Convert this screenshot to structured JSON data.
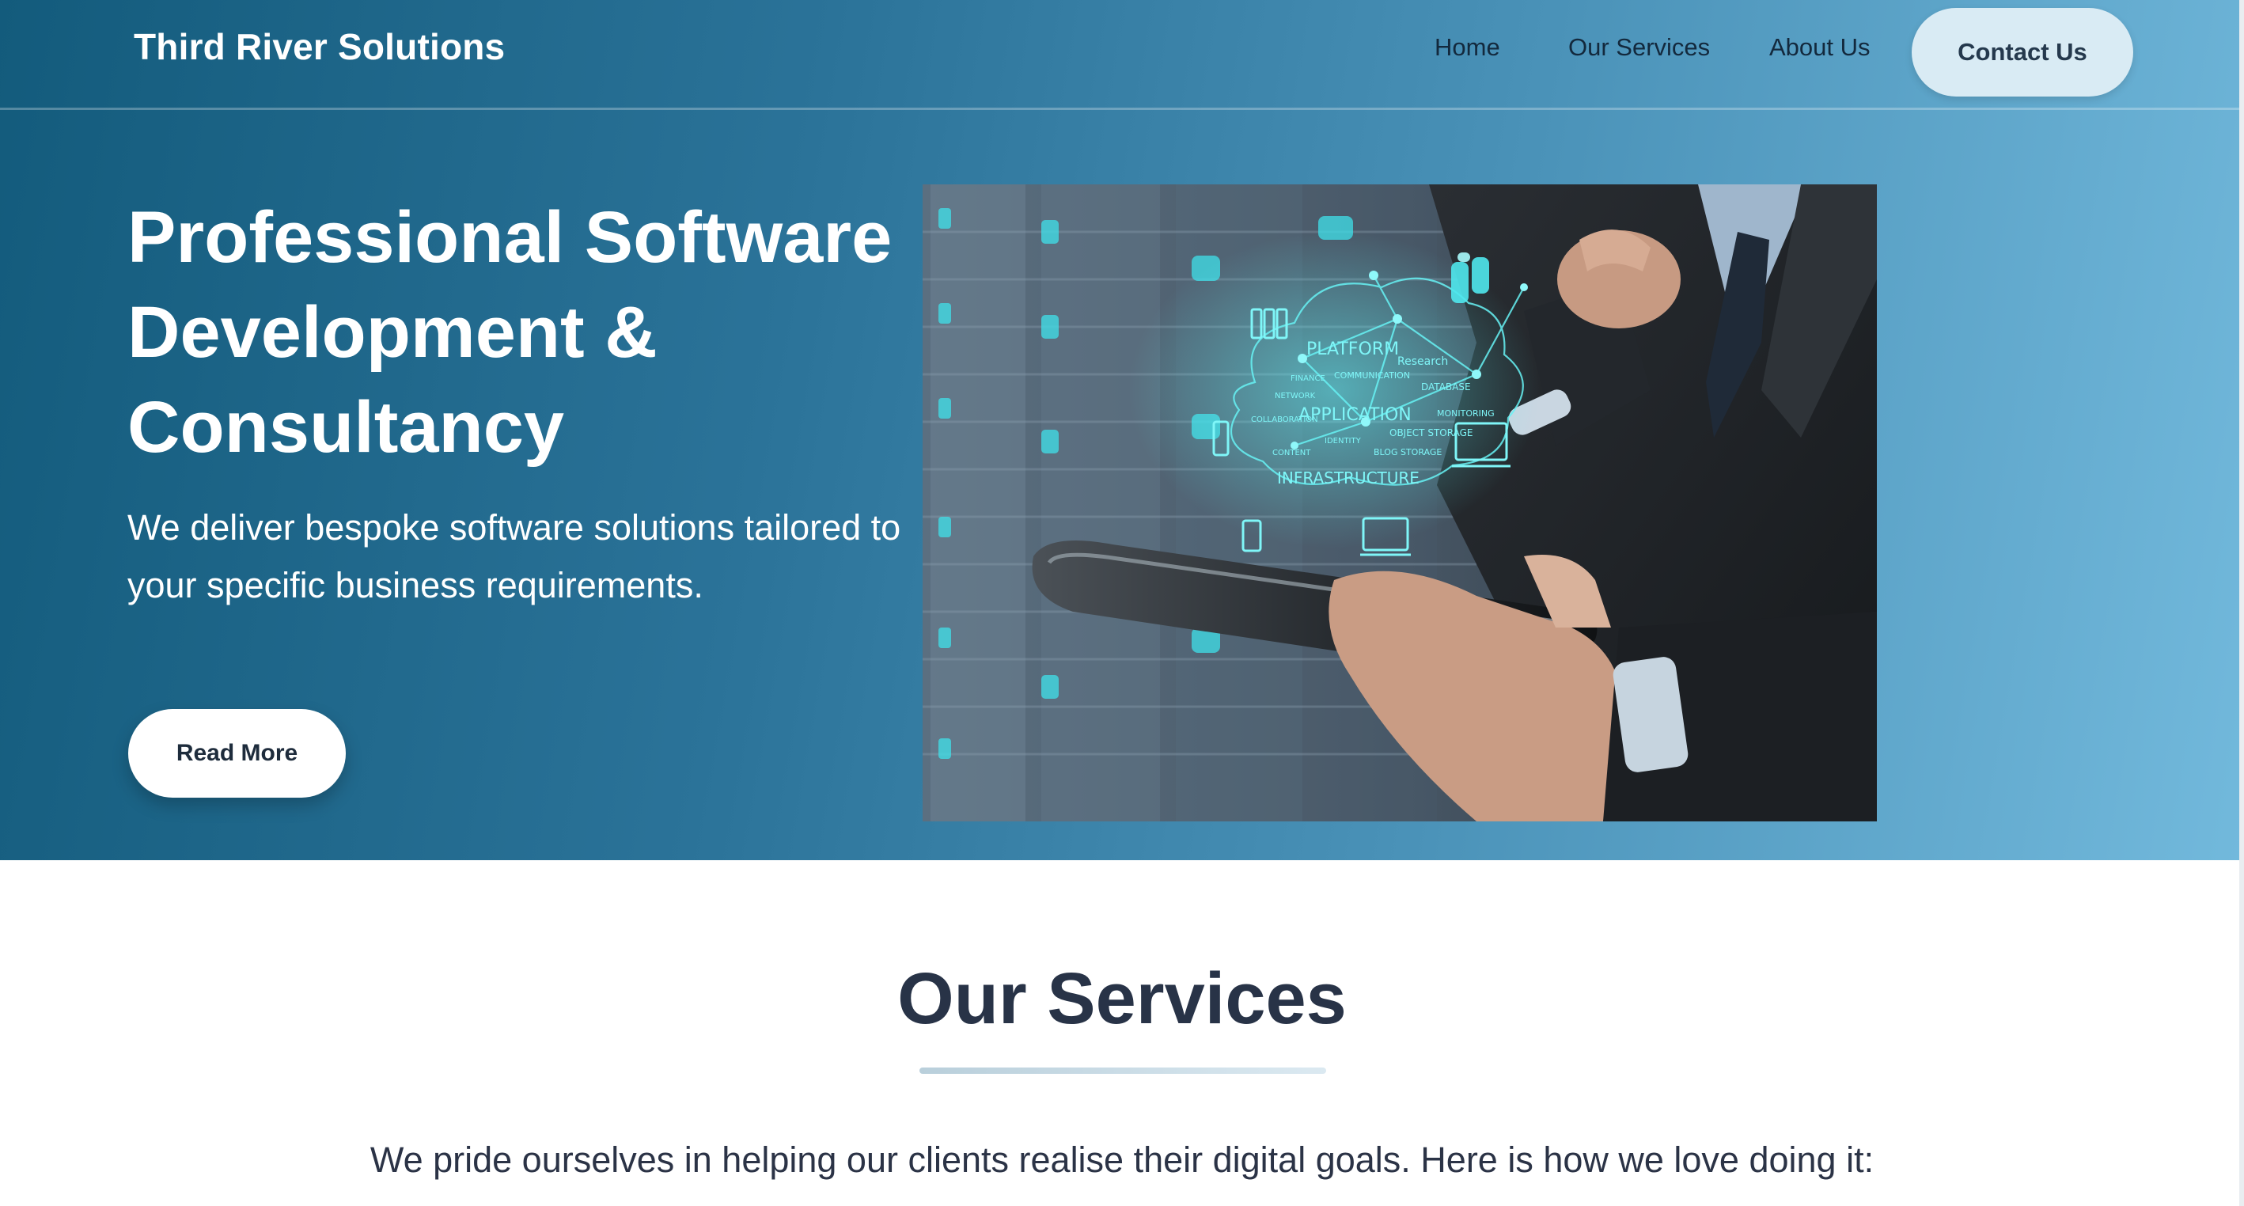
{
  "header": {
    "brand": "Third River Solutions",
    "nav": [
      {
        "label": "Home"
      },
      {
        "label": "Our Services"
      },
      {
        "label": "About Us"
      }
    ],
    "cta_label": "Contact Us"
  },
  "hero": {
    "title": "Professional Software Development & Consultancy",
    "subtitle": "We deliver bespoke software solutions tailored to your specific business requirements.",
    "button_label": "Read More",
    "image_words": {
      "platform": "PLATFORM",
      "application": "APPLICATION",
      "infrastructure": "INFRASTRUCTURE",
      "database": "DATABASE",
      "object_storage": "OBJECT STORAGE",
      "blog_storage": "BLOG STORAGE",
      "research": "Research",
      "communication": "COMMUNICATION",
      "collaboration": "COLLABORATION",
      "monitoring": "MONITORING",
      "identity": "IDENTITY",
      "content": "CONTENT",
      "finance": "FINANCE",
      "network": "NETWORK"
    }
  },
  "services": {
    "title": "Our Services",
    "intro": "We pride ourselves in helping our clients realise their digital goals. Here is how we love doing it:"
  },
  "colors": {
    "hero_gradient_start": "#135b7c",
    "hero_gradient_end": "#72b9dc",
    "contact_button_bg": "#d9ebf4",
    "heading_text": "#283347",
    "accent_cyan": "#4de3e8"
  }
}
